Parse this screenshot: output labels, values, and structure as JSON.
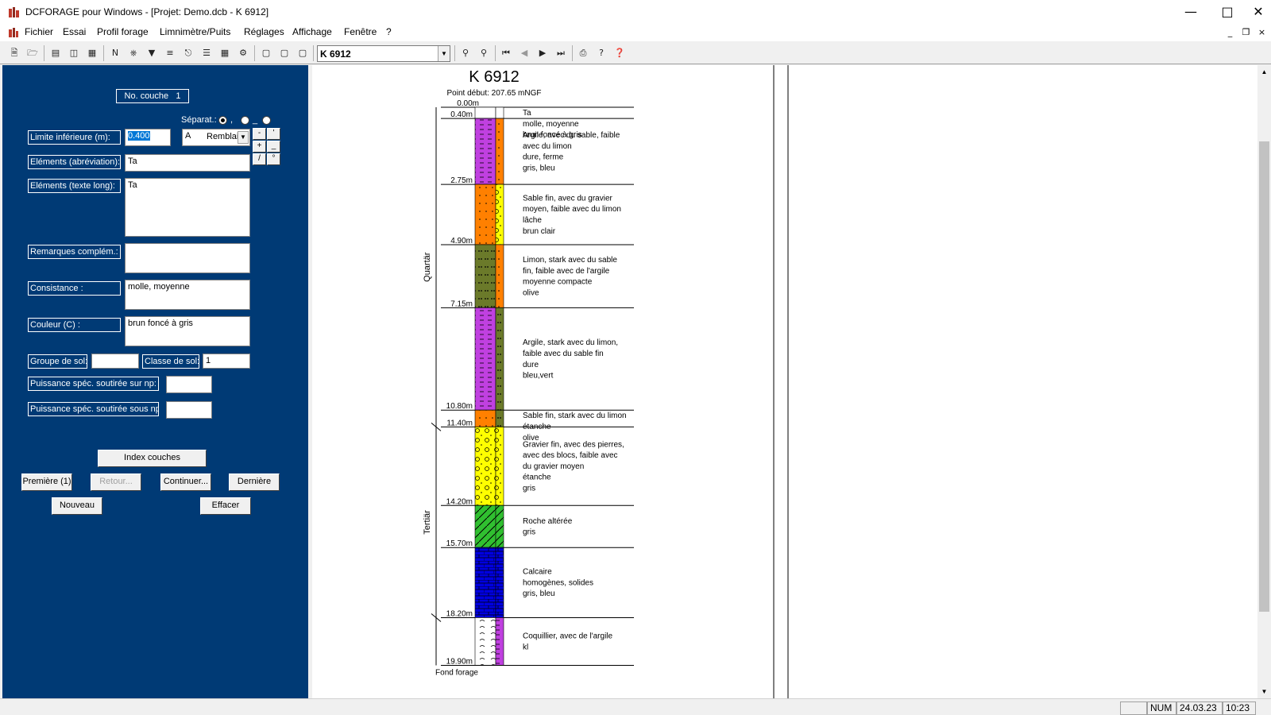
{
  "window": {
    "title": "DCFORAGE pour Windows - [Projet: Demo.dcb - K 6912]"
  },
  "menu": [
    "Fichier",
    "Essai",
    "Profil forage",
    "Limnimètre/Puits",
    "Réglages",
    "Affichage",
    "Fenêtre",
    "?"
  ],
  "toolbar": {
    "combo_value": "K 6912"
  },
  "form": {
    "no_couche_label": "No. couche",
    "no_couche_value": "1",
    "separator_label": "Séparat.:",
    "separator_marks": [
      ",",
      "_",
      ""
    ],
    "limite_label": "Limite inférieure      (m):",
    "limite_value": "0.400",
    "type_prefix": "A",
    "type_value": "Remblai",
    "small_buttons": [
      "-",
      "'",
      "+",
      "_",
      "/",
      "°"
    ],
    "elements_abrev_label": "Eléments (abréviation):",
    "elements_abrev_value": "Ta",
    "elements_long_label": "Eléments (texte long):",
    "elements_long_value": "Ta",
    "remarques_label": "Remarques complém.:",
    "remarques_value": "",
    "consistance_label": "Consistance :",
    "consistance_value": "molle, moyenne",
    "couleur_label": "Couleur (C) :",
    "couleur_value": "brun foncé à gris",
    "groupe_label": "Groupe de sol:",
    "groupe_value": "",
    "classe_label": "Classe de sol:",
    "classe_value": "1",
    "puissance_sur_label": "Puissance spéc. soutirée sur np:",
    "puissance_sur_value": "",
    "puissance_sous_label": "Puissance spéc. soutirée sous np :",
    "puissance_sous_value": "",
    "btn_index": "Index couches",
    "btn_premiere": "Première (1)",
    "btn_retour": "Retour...",
    "btn_continuer": "Continuer...",
    "btn_derniere": "Dernière",
    "btn_nouveau": "Nouveau",
    "btn_effacer": "Effacer"
  },
  "log": {
    "title": "K 6912",
    "start_point": "Point début: 207.65 mNGF",
    "top_depth": "0.00m",
    "end_label": "Fond forage",
    "units": [
      {
        "label": "Quartär",
        "top": 0.0,
        "bottom": 11.4
      },
      {
        "label": "Tertiär",
        "top": 11.4,
        "bottom": 18.2
      }
    ],
    "layers": [
      {
        "top": 0.0,
        "bottom": 0.4,
        "depth_label": "0.40m",
        "colors": [
          "#ffffff",
          "#ffffff"
        ],
        "pattern": "none",
        "desc": [
          "Ta",
          "molle, moyenne",
          "brun foncé à gris"
        ]
      },
      {
        "top": 0.4,
        "bottom": 2.75,
        "depth_label": "2.75m",
        "colors": [
          "#c040e0",
          "#ff8000"
        ],
        "pattern": "clay-sand",
        "desc": [
          "Argile, avec du sable, faible",
          "avec du limon",
          "dure, ferme",
          "gris, bleu"
        ]
      },
      {
        "top": 2.75,
        "bottom": 4.9,
        "depth_label": "4.90m",
        "colors": [
          "#ff8000",
          "#ffff00"
        ],
        "pattern": "sand-gravel",
        "desc": [
          "Sable fin, avec du gravier",
          "moyen, faible avec du limon",
          "lâche",
          "brun clair"
        ]
      },
      {
        "top": 4.9,
        "bottom": 7.15,
        "depth_label": "7.15m",
        "colors": [
          "#6b7a2a",
          "#ff8000"
        ],
        "pattern": "silt-sand",
        "desc": [
          "Limon, stark avec du sable",
          "fin, faible avec de l'argile",
          "moyenne compacte",
          "olive"
        ]
      },
      {
        "top": 7.15,
        "bottom": 10.8,
        "depth_label": "10.80m",
        "colors": [
          "#c040e0",
          "#6b7a2a"
        ],
        "pattern": "clay-silt",
        "desc": [
          "Argile, stark avec du limon,",
          "faible avec du sable fin",
          "dure",
          "bleu,vert"
        ]
      },
      {
        "top": 10.8,
        "bottom": 11.4,
        "depth_label": "11.40m",
        "colors": [
          "#ff8000",
          "#6b7a2a"
        ],
        "pattern": "sand-silt",
        "desc": [
          "Sable fin, stark avec du limon",
          "étanche",
          "olive"
        ]
      },
      {
        "top": 11.4,
        "bottom": 14.2,
        "depth_label": "14.20m",
        "colors": [
          "#ffff00",
          "#ffff00"
        ],
        "pattern": "gravel",
        "desc": [
          "Gravier fin, avec des pierres,",
          "avec des blocs, faible avec",
          "du gravier moyen",
          "étanche",
          "gris"
        ]
      },
      {
        "top": 14.2,
        "bottom": 15.7,
        "depth_label": "15.70m",
        "colors": [
          "#30c030",
          "#30c030"
        ],
        "pattern": "hatch",
        "desc": [
          "Roche altérée",
          "gris"
        ]
      },
      {
        "top": 15.7,
        "bottom": 18.2,
        "depth_label": "18.20m",
        "colors": [
          "#0000e0",
          "#0000e0"
        ],
        "pattern": "brick",
        "desc": [
          "Calcaire",
          "homogènes, solides",
          "gris, bleu"
        ]
      },
      {
        "top": 18.2,
        "bottom": 19.9,
        "depth_label": "19.90m",
        "colors": [
          "#ffffff",
          "#c040e0"
        ],
        "pattern": "shell",
        "desc": [
          "Coquillier, avec de l'argile",
          "kl"
        ]
      }
    ]
  },
  "status": {
    "num": "NUM",
    "date": "24.03.23",
    "time": "10:23"
  }
}
